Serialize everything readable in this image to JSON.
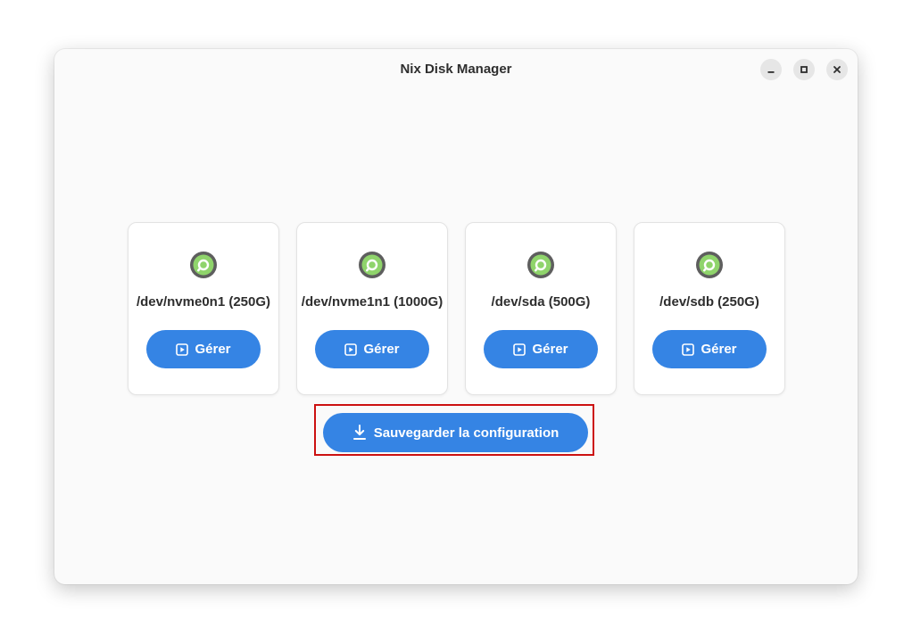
{
  "window": {
    "title": "Nix Disk Manager"
  },
  "titlebar_buttons": {
    "minimize_icon": "minimize-icon",
    "maximize_icon": "maximize-icon",
    "close_icon": "close-icon"
  },
  "disks": [
    {
      "label": "/dev/nvme0n1 (250G)",
      "button_label": "Gérer",
      "icon": "disk-icon"
    },
    {
      "label": "/dev/nvme1n1 (1000G)",
      "button_label": "Gérer",
      "icon": "disk-icon"
    },
    {
      "label": "/dev/sda (500G)",
      "button_label": "Gérer",
      "icon": "disk-icon"
    },
    {
      "label": "/dev/sdb (250G)",
      "button_label": "Gérer",
      "icon": "disk-icon"
    }
  ],
  "save": {
    "label": "Sauvegarder la configuration",
    "icon": "download-icon"
  },
  "colors": {
    "accent": "#3584e4",
    "highlight": "#cc1111",
    "disk_icon_outer": "#5e5e5e",
    "disk_icon_inner": "#8fd46b"
  }
}
